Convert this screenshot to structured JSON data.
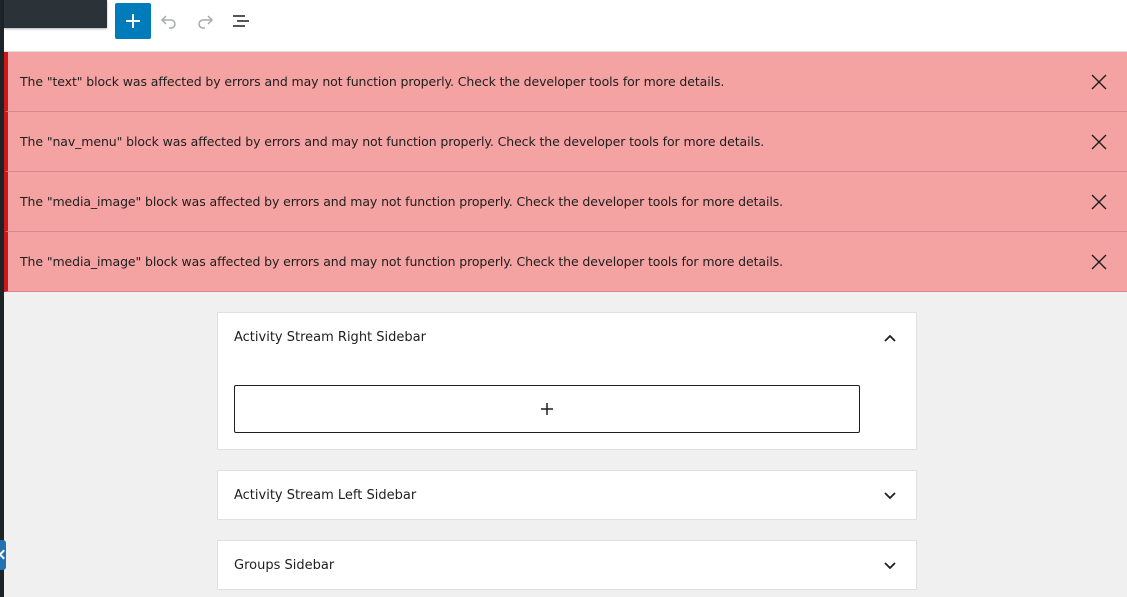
{
  "toolbar": {
    "add_block_label": "+",
    "undo_icon": "undo-icon",
    "redo_icon": "redo-icon",
    "list_view_icon": "list-view-icon",
    "accent": "#007cba"
  },
  "notices": [
    {
      "text": "The \"text\" block was affected by errors and may not function properly. Check the developer tools for more details."
    },
    {
      "text": "The \"nav_menu\" block was affected by errors and may not function properly. Check the developer tools for more details."
    },
    {
      "text": "The \"media_image\" block was affected by errors and may not function properly. Check the developer tools for more details."
    },
    {
      "text": "The \"media_image\" block was affected by errors and may not function properly. Check the developer tools for more details."
    }
  ],
  "notice_colors": {
    "background": "#f4a2a2",
    "border": "#cc1818"
  },
  "widget_areas": [
    {
      "title": "Activity Stream Right Sidebar",
      "state": "expanded",
      "appender_label": "+"
    },
    {
      "title": "Activity Stream Left Sidebar",
      "state": "collapsed"
    },
    {
      "title": "Groups Sidebar",
      "state": "collapsed"
    }
  ]
}
